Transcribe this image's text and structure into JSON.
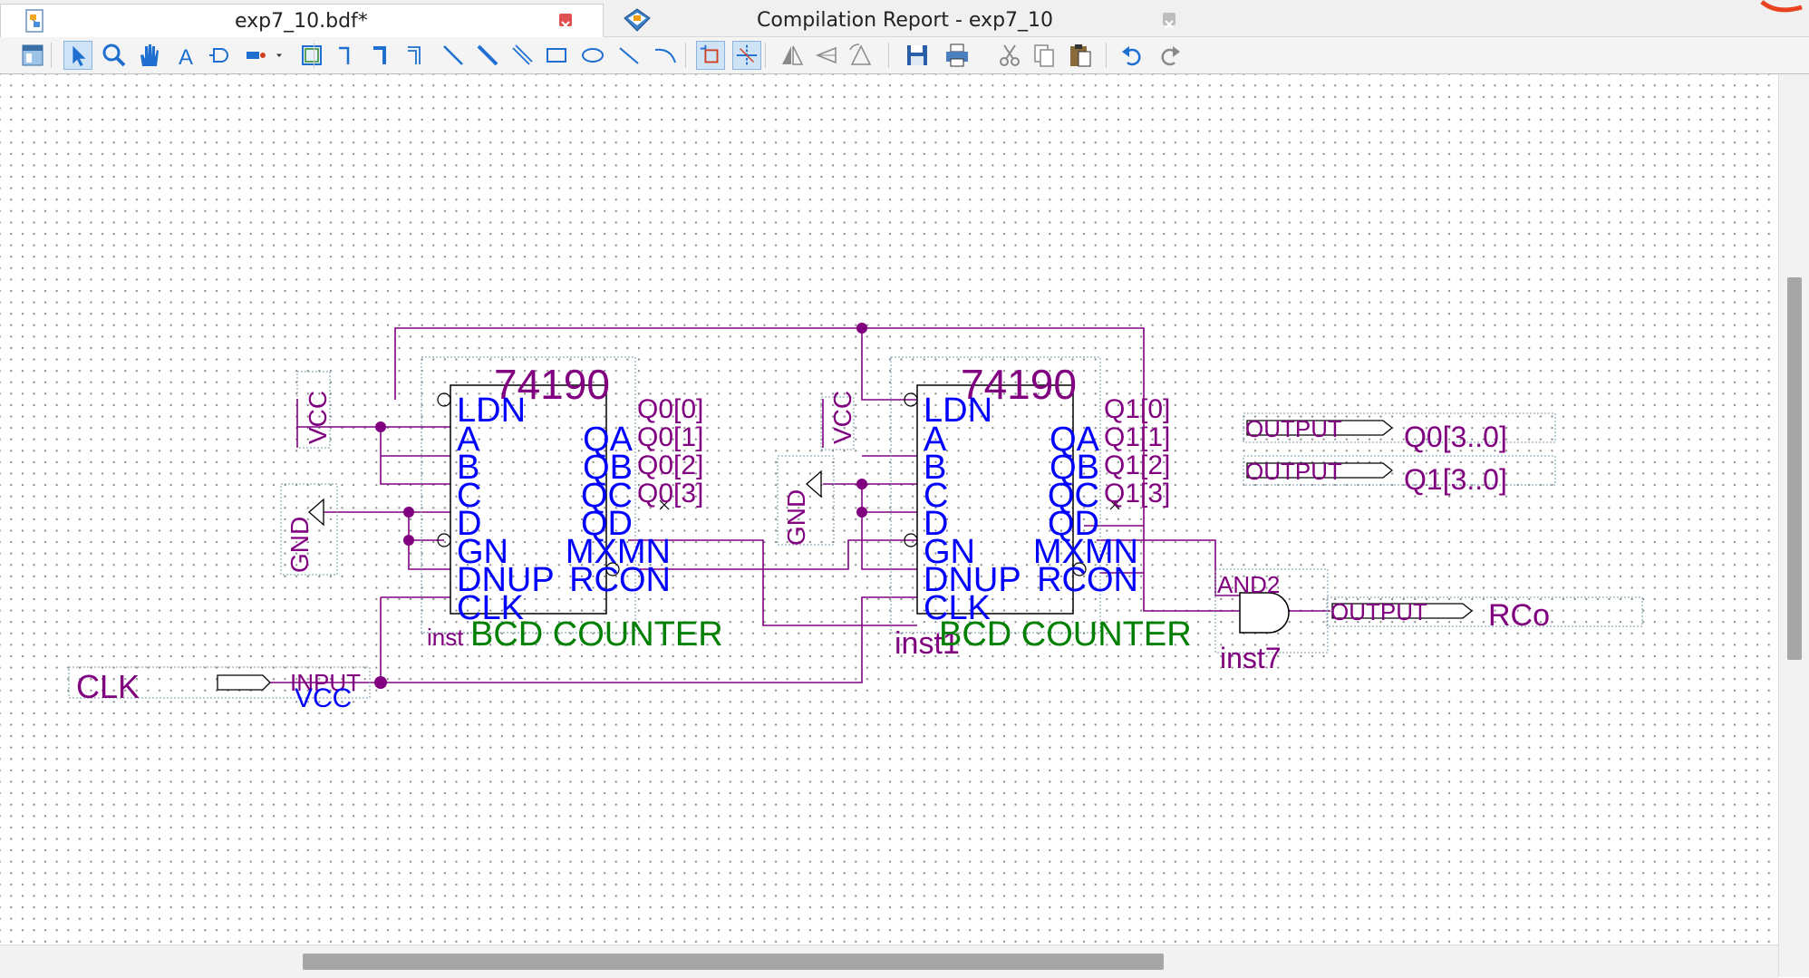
{
  "tabs": [
    {
      "label": "exp7_10.bdf*",
      "active": true
    },
    {
      "label": "Compilation Report - exp7_10",
      "active": false
    }
  ],
  "toolbar": {
    "tools": [
      "toolbar-icon",
      "selection-tool-icon",
      "zoom-tool-icon",
      "hand-tool-icon",
      "text-tool-icon",
      "symbol-tool-icon",
      "pin-tool-icon",
      "dropdown-arrow-icon",
      "block-tool-icon",
      "orthogonal-node-tool-icon",
      "orthogonal-bus-tool-icon",
      "orthogonal-conduit-tool-icon",
      "diagonal-node-tool-icon",
      "diagonal-bus-tool-icon",
      "diagonal-conduit-tool-icon",
      "rectangle-tool-icon",
      "oval-tool-icon",
      "line-tool-icon",
      "arc-tool-icon",
      "rubberbanding-icon",
      "partial-line-selection-icon",
      "flip-horizontal-icon",
      "flip-vertical-icon",
      "rotate-icon",
      "save-icon",
      "print-icon",
      "cut-icon",
      "copy-icon",
      "paste-icon",
      "undo-icon",
      "redo-icon"
    ]
  },
  "colors": {
    "wire": "#800080",
    "pin_text": "#0000ff",
    "label_text": "#800080",
    "block_title": "#008000",
    "part_number": "#800080",
    "grid_dot": "#8a8a8a"
  },
  "schematic": {
    "counter0": {
      "part": "74190",
      "instance": "inst",
      "description": "BCD COUNTER",
      "left_pins": [
        "LDN",
        "A",
        "B",
        "C",
        "D",
        "GN",
        "DNUP",
        "CLK"
      ],
      "right_pins": [
        "QA",
        "QB",
        "QC",
        "QD",
        "MXMN",
        "RCON"
      ],
      "outputs": [
        "Q0[0]",
        "Q0[1]",
        "Q0[2]",
        "Q0[3]"
      ]
    },
    "counter1": {
      "part": "74190",
      "instance": "inst1",
      "description": "BCD COUNTER",
      "left_pins": [
        "LDN",
        "A",
        "B",
        "C",
        "D",
        "GN",
        "DNUP",
        "CLK"
      ],
      "right_pins": [
        "QA",
        "QB",
        "QC",
        "QD",
        "MXMN",
        "RCON"
      ],
      "outputs": [
        "Q1[0]",
        "Q1[1]",
        "Q1[2]",
        "Q1[3]"
      ]
    },
    "and_gate": {
      "type": "AND2",
      "instance": "inst7"
    },
    "vcc0": "VCC",
    "vcc1": "VCC",
    "gnd0": "GND",
    "gnd1": "GND",
    "input_pin": {
      "name": "CLK",
      "type": "INPUT",
      "default": "VCC"
    },
    "output_pins": [
      {
        "type": "OUTPUT",
        "name": "Q0[3..0]"
      },
      {
        "type": "OUTPUT",
        "name": "Q1[3..0]"
      },
      {
        "type": "OUTPUT",
        "name": "RCo"
      }
    ]
  }
}
